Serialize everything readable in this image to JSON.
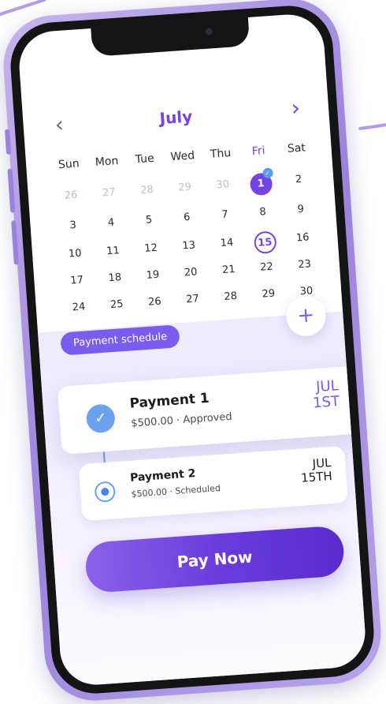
{
  "calendar": {
    "month": "July",
    "prev_icon": "chevron-left-icon",
    "next_icon": "chevron-right-icon",
    "weekdays": [
      "Sun",
      "Mon",
      "Tue",
      "Wed",
      "Thu",
      "Fri",
      "Sat"
    ],
    "highlight_weekday": "Fri",
    "weeks": [
      [
        "26",
        "27",
        "28",
        "29",
        "30",
        "1",
        "2"
      ],
      [
        "3",
        "4",
        "5",
        "6",
        "7",
        "8",
        "9"
      ],
      [
        "10",
        "11",
        "12",
        "13",
        "14",
        "15",
        "16"
      ],
      [
        "17",
        "18",
        "19",
        "20",
        "21",
        "22",
        "23"
      ],
      [
        "24",
        "25",
        "26",
        "27",
        "28",
        "29",
        "30"
      ]
    ],
    "selected_day": "1",
    "marked_day": "15"
  },
  "schedule": {
    "label": "Payment schedule",
    "add_icon": "plus-icon",
    "payments": [
      {
        "title": "Payment 1",
        "detail": "$500.00 · Approved",
        "date_line1": "JUL",
        "date_line2": "1ST",
        "status_icon": "check-icon"
      },
      {
        "title": "Payment 2",
        "detail": "$500.00 · Scheduled",
        "date_line1": "JUL",
        "date_line2": "15TH",
        "status_icon": "radio-dot-icon"
      }
    ]
  },
  "actions": {
    "pay_now": "Pay Now"
  },
  "colors": {
    "accent": "#7442e6",
    "check_blue": "#6aa2ee",
    "frame": "#9a82dc"
  }
}
